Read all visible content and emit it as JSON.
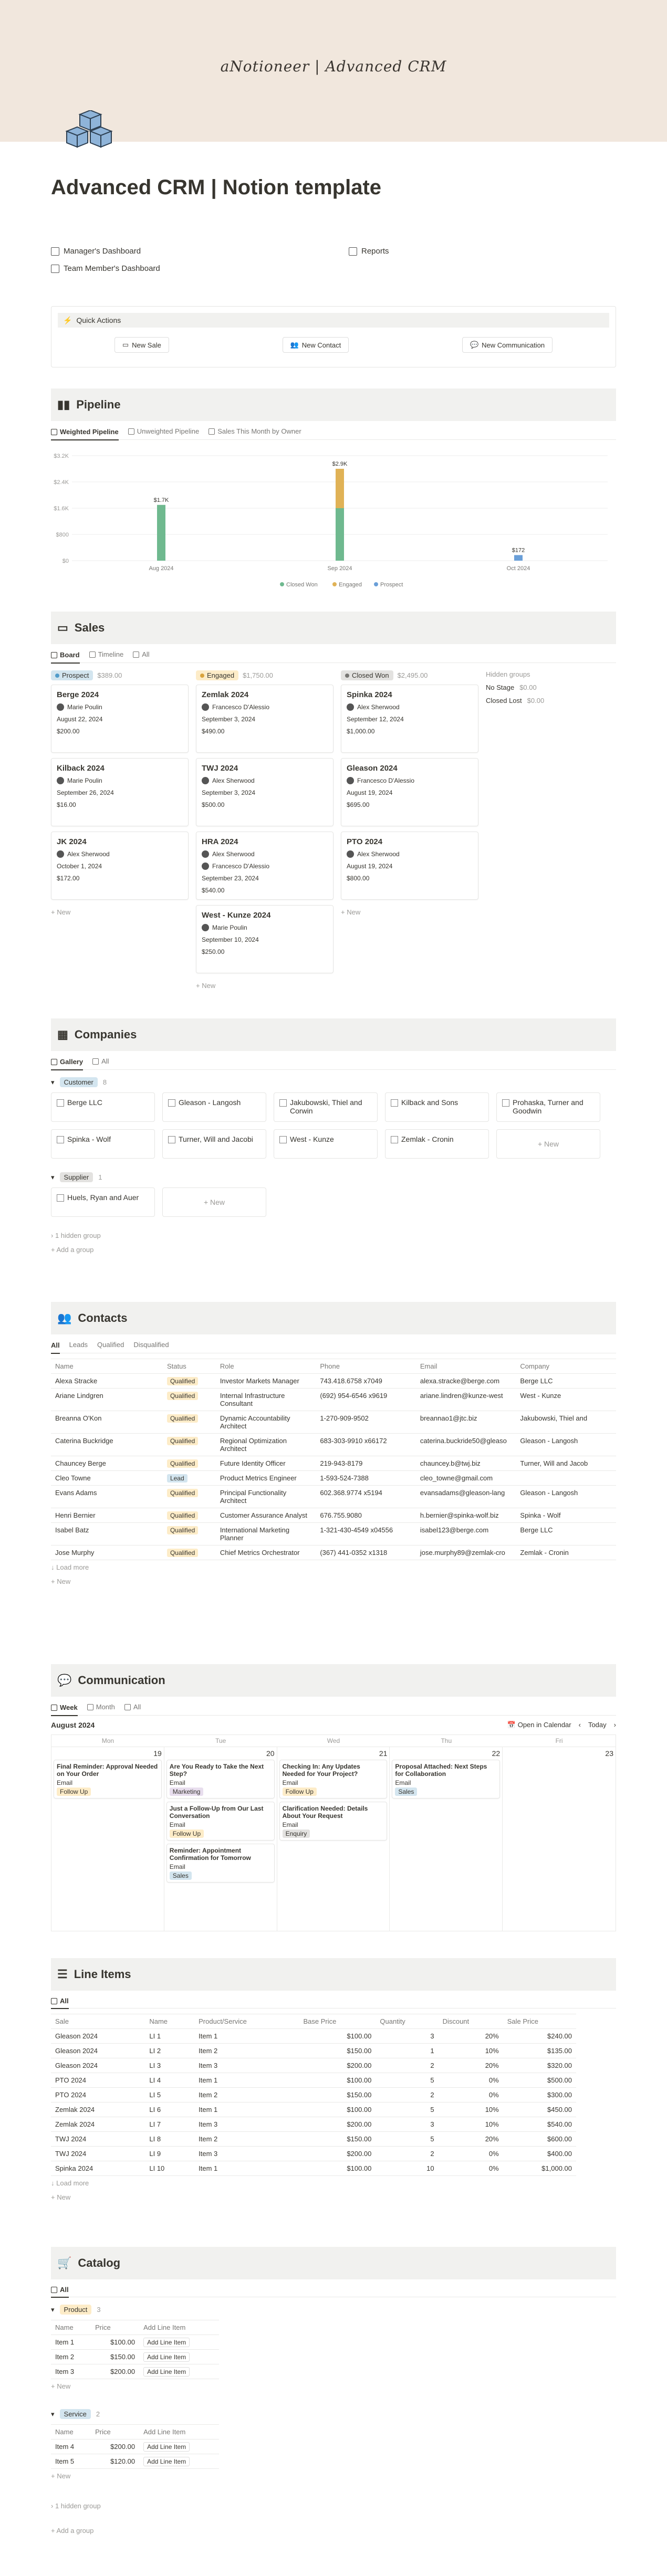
{
  "cover_title": "aNotioneer | Advanced CRM",
  "page_title": "Advanced CRM | Notion template",
  "links": {
    "manager": "Manager's Dashboard",
    "team": "Team Member's Dashboard",
    "reports": "Reports"
  },
  "quick_actions": {
    "title": "Quick Actions",
    "buttons": [
      "New Sale",
      "New Contact",
      "New Communication"
    ]
  },
  "pipeline": {
    "title": "Pipeline",
    "tabs": [
      "Weighted Pipeline",
      "Unweighted Pipeline",
      "Sales This Month by Owner"
    ],
    "chart_data": {
      "type": "bar",
      "categories": [
        "Aug 2024",
        "Sep 2024",
        "Oct 2024"
      ],
      "series": [
        {
          "name": "Closed Won",
          "color": "#6fb98f",
          "values": [
            1.7,
            1.6,
            0
          ]
        },
        {
          "name": "Engaged",
          "color": "#e0b256",
          "values": [
            0,
            1.2,
            0
          ]
        },
        {
          "name": "Prospect",
          "color": "#6a9fd8",
          "values": [
            0,
            0,
            0.17
          ]
        }
      ],
      "data_labels": [
        "$1.7K",
        "$2.9K",
        "$172"
      ],
      "y_ticks": [
        "$3.2K",
        "$2.4K",
        "$1.6K",
        "$800",
        "$0"
      ],
      "ylim": [
        0,
        3.2
      ]
    }
  },
  "sales": {
    "title": "Sales",
    "tabs": [
      "Board",
      "Timeline",
      "All"
    ],
    "columns": [
      {
        "name": "Prospect",
        "total": "$389.00",
        "color": "#d3e5ef",
        "dot": "#529cca",
        "cards": [
          {
            "title": "Berge 2024",
            "owner": "Marie Poulin",
            "date": "August 22, 2024",
            "amount": "$200.00"
          },
          {
            "title": "Kilback 2024",
            "owner": "Marie Poulin",
            "date": "September 26, 2024",
            "amount": "$16.00"
          },
          {
            "title": "JK 2024",
            "owner": "Alex Sherwood",
            "date": "October 1, 2024",
            "amount": "$172.00"
          }
        ]
      },
      {
        "name": "Engaged",
        "total": "$1,750.00",
        "color": "#fdecc8",
        "dot": "#d9a33d",
        "cards": [
          {
            "title": "Zemlak 2024",
            "owner": "Francesco D'Alessio",
            "date": "September 3, 2024",
            "amount": "$490.00"
          },
          {
            "title": "TWJ 2024",
            "owner": "Alex Sherwood",
            "date": "September 3, 2024",
            "amount": "$500.00"
          },
          {
            "title": "HRA 2024",
            "owner": "Alex Sherwood",
            "owner2": "Francesco D'Alessio",
            "date": "September 23, 2024",
            "amount": "$540.00"
          },
          {
            "title": "West - Kunze 2024",
            "owner": "Marie Poulin",
            "date": "September 10, 2024",
            "amount": "$250.00"
          }
        ]
      },
      {
        "name": "Closed Won",
        "total": "$2,495.00",
        "color": "#e3e2e0",
        "dot": "#787774",
        "cards": [
          {
            "title": "Spinka 2024",
            "owner": "Alex Sherwood",
            "date": "September 12, 2024",
            "amount": "$1,000.00"
          },
          {
            "title": "Gleason 2024",
            "owner": "Francesco D'Alessio",
            "date": "August 19, 2024",
            "amount": "$695.00"
          },
          {
            "title": "PTO 2024",
            "owner": "Alex Sherwood",
            "date": "August 19, 2024",
            "amount": "$800.00"
          }
        ]
      }
    ],
    "hidden_label": "Hidden groups",
    "hidden": [
      {
        "name": "No Stage",
        "total": "$0.00"
      },
      {
        "name": "Closed Lost",
        "total": "$0.00"
      }
    ],
    "new": "New"
  },
  "companies": {
    "title": "Companies",
    "tabs": [
      "Gallery",
      "All"
    ],
    "customer_label": "Customer",
    "customer_count": "8",
    "customers": [
      "Berge LLC",
      "Gleason - Langosh",
      "Jakubowski, Thiel and Corwin",
      "Kilback and Sons",
      "Prohaska, Turner and Goodwin",
      "Spinka - Wolf",
      "Turner, Will and Jacobi",
      "West - Kunze",
      "Zemlak - Cronin"
    ],
    "supplier_label": "Supplier",
    "supplier_count": "1",
    "suppliers": [
      "Huels, Ryan and Auer"
    ],
    "hidden_group": "1 hidden group",
    "add_group": "Add a group",
    "new": "New"
  },
  "contacts": {
    "title": "Contacts",
    "tabs": [
      "All",
      "Leads",
      "Qualified",
      "Disqualified"
    ],
    "headers": [
      "Name",
      "Status",
      "Role",
      "Phone",
      "Email",
      "Company"
    ],
    "rows": [
      [
        "Alexa Stracke",
        "Qualified",
        "Investor Markets Manager",
        "743.418.6758 x7049",
        "alexa.stracke@berge.com",
        "Berge LLC"
      ],
      [
        "Ariane Lindgren",
        "Qualified",
        "Internal Infrastructure Consultant",
        "(692) 954-6546 x9619",
        "ariane.lindren@kunze-west",
        "West - Kunze"
      ],
      [
        "Breanna O'Kon",
        "Qualified",
        "Dynamic Accountability Architect",
        "1-270-909-9502",
        "breannao1@jtc.biz",
        "Jakubowski, Thiel and"
      ],
      [
        "Caterina Buckridge",
        "Qualified",
        "Regional Optimization Architect",
        "683-303-9910 x66172",
        "caterina.buckride50@gleaso",
        "Gleason - Langosh"
      ],
      [
        "Chauncey Berge",
        "Qualified",
        "Future Identity Officer",
        "219-943-8179",
        "chauncey.b@twj.biz",
        "Turner, Will and Jacob"
      ],
      [
        "Cleo Towne",
        "Lead",
        "Product Metrics Engineer",
        "1-593-524-7388",
        "cleo_towne@gmail.com",
        ""
      ],
      [
        "Evans Adams",
        "Qualified",
        "Principal Functionality Architect",
        "602.368.9774 x5194",
        "evansadams@gleason-lang",
        "Gleason - Langosh"
      ],
      [
        "Henri Bernier",
        "Qualified",
        "Customer Assurance Analyst",
        "676.755.9080",
        "h.bernier@spinka-wolf.biz",
        "Spinka - Wolf"
      ],
      [
        "Isabel Batz",
        "Qualified",
        "International Marketing Planner",
        "1-321-430-4549 x04556",
        "isabel123@berge.com",
        "Berge LLC"
      ],
      [
        "Jose Murphy",
        "Qualified",
        "Chief Metrics Orchestrator",
        "(367) 441-0352 x1318",
        "jose.murphy89@zemlak-cro",
        "Zemlak - Cronin"
      ]
    ],
    "load_more": "Load more",
    "new": "New"
  },
  "communication": {
    "title": "Communication",
    "tabs": [
      "Week",
      "Month",
      "All"
    ],
    "month": "August 2024",
    "open_cal": "Open in Calendar",
    "today": "Today",
    "days": [
      {
        "name": "Mon",
        "num": "19",
        "events": [
          {
            "t": "Final Reminder: Approval Needed on Your Order",
            "m": "Email",
            "tag": "Follow Up",
            "tc": "#fdecc8"
          }
        ]
      },
      {
        "name": "Tue",
        "num": "20",
        "events": [
          {
            "t": "Are You Ready to Take the Next Step?",
            "m": "Email",
            "tag": "Marketing",
            "tc": "#e8deee"
          },
          {
            "t": "Just a Follow-Up from Our Last Conversation",
            "m": "Email",
            "tag": "Follow Up",
            "tc": "#fdecc8"
          },
          {
            "t": "Reminder: Appointment Confirmation for Tomorrow",
            "m": "Email",
            "tag": "Sales",
            "tc": "#d3e5ef"
          }
        ]
      },
      {
        "name": "Wed",
        "num": "21",
        "events": [
          {
            "t": "Checking In: Any Updates Needed for Your Project?",
            "m": "Email",
            "tag": "Follow Up",
            "tc": "#fdecc8"
          },
          {
            "t": "Clarification Needed: Details About Your Request",
            "m": "Email",
            "tag": "Enquiry",
            "tc": "#e3e2e0"
          }
        ]
      },
      {
        "name": "Thu",
        "num": "22",
        "events": [
          {
            "t": "Proposal Attached: Next Steps for Collaboration",
            "m": "Email",
            "tag": "Sales",
            "tc": "#d3e5ef"
          }
        ]
      },
      {
        "name": "Fri",
        "num": "23",
        "events": []
      }
    ]
  },
  "line_items": {
    "title": "Line Items",
    "tabs": [
      "All"
    ],
    "headers": [
      "Sale",
      "Name",
      "Product/Service",
      "Base Price",
      "Quantity",
      "Discount",
      "Sale Price"
    ],
    "rows": [
      [
        "Gleason 2024",
        "LI 1",
        "Item 1",
        "$100.00",
        "3",
        "20%",
        "$240.00"
      ],
      [
        "Gleason 2024",
        "LI 2",
        "Item 2",
        "$150.00",
        "1",
        "10%",
        "$135.00"
      ],
      [
        "Gleason 2024",
        "LI 3",
        "Item 3",
        "$200.00",
        "2",
        "20%",
        "$320.00"
      ],
      [
        "PTO 2024",
        "LI 4",
        "Item 1",
        "$100.00",
        "5",
        "0%",
        "$500.00"
      ],
      [
        "PTO 2024",
        "LI 5",
        "Item 2",
        "$150.00",
        "2",
        "0%",
        "$300.00"
      ],
      [
        "Zemlak 2024",
        "LI 6",
        "Item 1",
        "$100.00",
        "5",
        "10%",
        "$450.00"
      ],
      [
        "Zemlak 2024",
        "LI 7",
        "Item 3",
        "$200.00",
        "3",
        "10%",
        "$540.00"
      ],
      [
        "TWJ 2024",
        "LI 8",
        "Item 2",
        "$150.00",
        "5",
        "20%",
        "$600.00"
      ],
      [
        "TWJ 2024",
        "LI 9",
        "Item 3",
        "$200.00",
        "2",
        "0%",
        "$400.00"
      ],
      [
        "Spinka 2024",
        "LI 10",
        "Item 1",
        "$100.00",
        "10",
        "0%",
        "$1,000.00"
      ]
    ],
    "load_more": "Load more",
    "new": "New"
  },
  "catalog": {
    "title": "Catalog",
    "tabs": [
      "All"
    ],
    "product_label": "Product",
    "product_count": "3",
    "headers": [
      "Name",
      "Price",
      "Add Line Item"
    ],
    "products": [
      [
        "Item 1",
        "$100.00"
      ],
      [
        "Item 2",
        "$150.00"
      ],
      [
        "Item 3",
        "$200.00"
      ]
    ],
    "service_label": "Service",
    "service_count": "2",
    "services": [
      [
        "Item 4",
        "$200.00"
      ],
      [
        "Item 5",
        "$120.00"
      ]
    ],
    "add_btn": "Add Line Item",
    "hidden_group": "1 hidden group",
    "add_group": "Add a group",
    "new": "New"
  }
}
